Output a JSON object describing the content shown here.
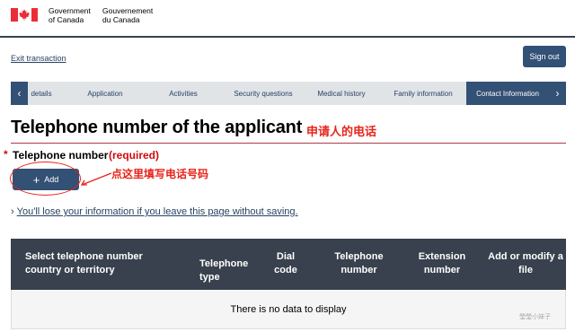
{
  "header": {
    "gov_en_line1": "Government",
    "gov_en_line2": "of Canada",
    "gov_fr_line1": "Gouvernement",
    "gov_fr_line2": "du Canada"
  },
  "nav": {
    "exit_label": "Exit transaction",
    "signout_label": "Sign out"
  },
  "tabs": {
    "items": [
      {
        "label": "details"
      },
      {
        "label": "Application"
      },
      {
        "label": "Activities"
      },
      {
        "label": "Security questions"
      },
      {
        "label": "Medical history"
      },
      {
        "label": "Family information"
      },
      {
        "label": "Contact Information"
      }
    ],
    "active": "Contact Information",
    "left_arrow": "‹",
    "right_arrow": "›"
  },
  "page": {
    "title": "Telephone number of the applicant",
    "title_annotation": "申请人的电话"
  },
  "field": {
    "required_mark": "*",
    "label": "Telephone number",
    "required_text": "(required)",
    "add_label": "Add",
    "add_icon": "+",
    "add_annotation": "点这里填写电话号码"
  },
  "warning": {
    "chevron": "›",
    "text": "You'll lose your information if you leave this page without saving."
  },
  "table": {
    "headers": [
      "Select telephone number country or territory",
      "Telephone type",
      "Dial code",
      "Telephone number",
      "Extension number",
      "Add or modify a file"
    ],
    "empty_message": "There is no data to display"
  },
  "watermark": "瑩瑩小妹子",
  "colors": {
    "primary": "#335075",
    "link": "#284162",
    "title_rule": "#af3c43",
    "required": "#d3080c",
    "annotation": "#e8241a",
    "table_header": "#38414d",
    "flag_red": "#eb2d37"
  }
}
